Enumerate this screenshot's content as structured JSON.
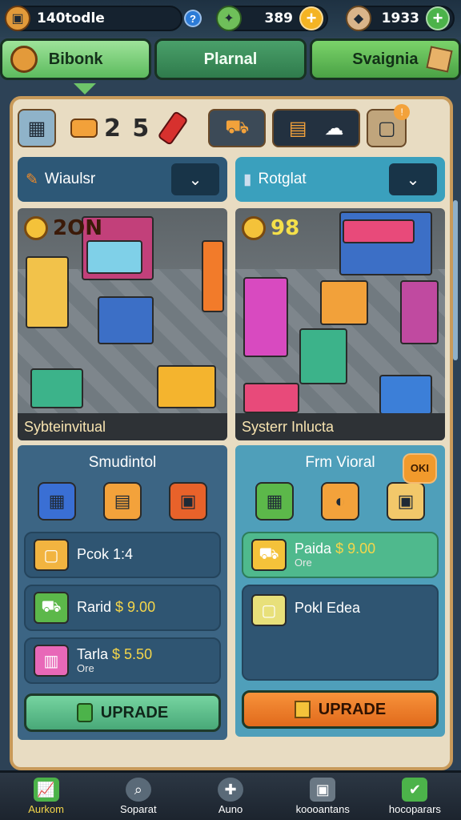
{
  "topbar": {
    "left_value": "140todle",
    "help": "?",
    "mid_value": "389",
    "right_value": "1933",
    "plus": "+"
  },
  "tabs": [
    {
      "label": "Bibonk"
    },
    {
      "label": "Plarnal"
    },
    {
      "label": "Svaignia"
    }
  ],
  "toolbar": {
    "counter": "2 5",
    "badge": "!"
  },
  "left": {
    "header": "Wiaulsr",
    "scene_badge": "2ON",
    "scene_caption": "Sybteinvitual",
    "subtitle": "Smudintol",
    "items": [
      {
        "name": "Pcok",
        "price": "1:4",
        "sub": ""
      },
      {
        "name": "Rarid",
        "price": "$ 9.00",
        "sub": ""
      },
      {
        "name": "Tarla",
        "price": "$ 5.50",
        "sub": "Ore"
      }
    ],
    "upgrade": "UPRADE"
  },
  "right": {
    "header": "Rotglat",
    "scene_badge": "98",
    "scene_caption": "Systerr Inlucta",
    "subtitle": "Frm Vioral",
    "pill": "OKI",
    "items": [
      {
        "name": "Paida",
        "price": "$ 9.00",
        "sub": "Ore"
      },
      {
        "name": "Pokl Edea",
        "price": "",
        "sub": ""
      }
    ],
    "upgrade": "UPRADE"
  },
  "bottom": [
    {
      "label": "Aurkom"
    },
    {
      "label": "Soparat"
    },
    {
      "label": "Auno"
    },
    {
      "label": "koooantans"
    },
    {
      "label": "hocoparars"
    }
  ],
  "colors": {
    "accent_green": "#5dbb5e",
    "accent_orange": "#f7923a",
    "panel_bg": "#e8dcc2",
    "dark_bg": "#2d4256"
  }
}
